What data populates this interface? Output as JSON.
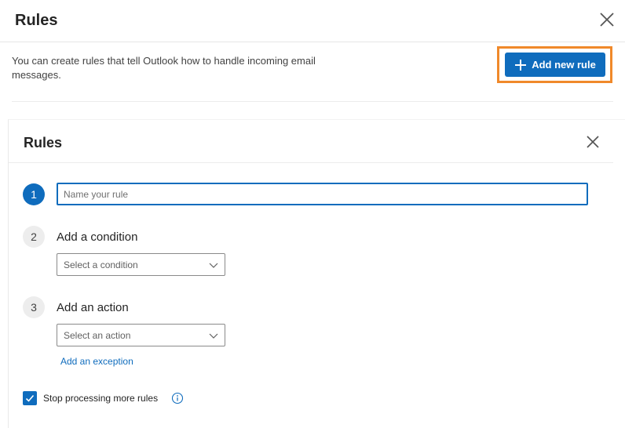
{
  "header": {
    "title": "Rules",
    "description": "You can create rules that tell Outlook how to handle incoming email messages.",
    "add_rule_label": "Add new rule"
  },
  "panel": {
    "title": "Rules",
    "step1": {
      "number": "1",
      "placeholder": "Name your rule",
      "value": ""
    },
    "step2": {
      "number": "2",
      "label": "Add a condition",
      "select_value": "Select a condition"
    },
    "step3": {
      "number": "3",
      "label": "Add an action",
      "select_value": "Select an action"
    },
    "exception_link": "Add an exception",
    "stop_processing": {
      "label": "Stop processing more rules",
      "checked": true
    }
  },
  "icons": [
    "close-icon",
    "plus-icon",
    "chevron-down-icon",
    "checkmark-icon",
    "info-icon"
  ],
  "colors": {
    "accent": "#0f6cbd",
    "highlight": "#f0892a"
  }
}
